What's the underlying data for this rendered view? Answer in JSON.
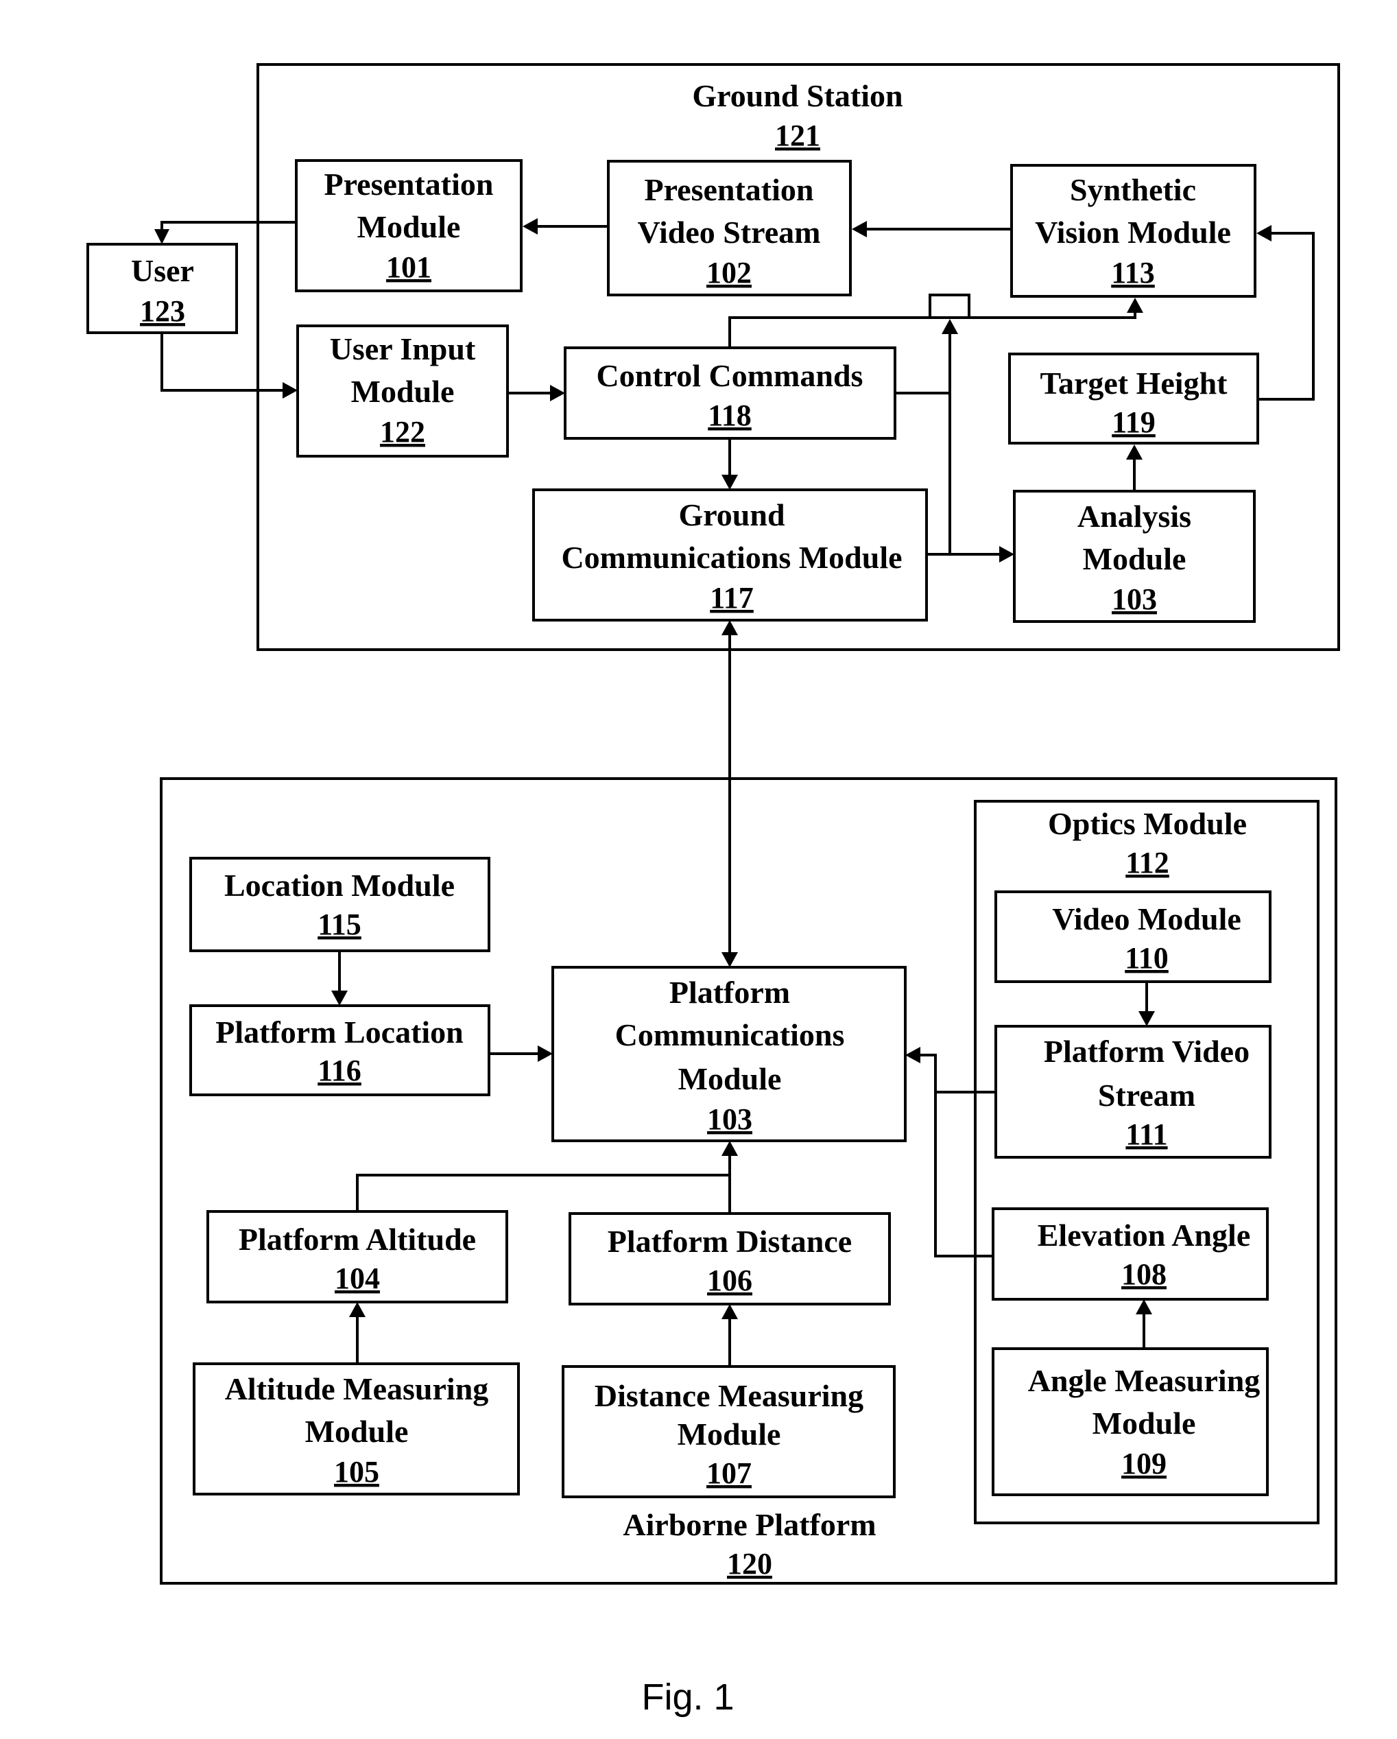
{
  "figure": {
    "caption": "Fig. 1"
  },
  "ground_station": {
    "title": "Ground Station",
    "ref": "121",
    "modules": {
      "presentation_module": {
        "lines": [
          "Presentation",
          "Module"
        ],
        "ref": "101"
      },
      "presentation_video_stream": {
        "lines": [
          "Presentation",
          "Video Stream"
        ],
        "ref": "102"
      },
      "synthetic_vision_module": {
        "lines": [
          "Synthetic",
          "Vision Module"
        ],
        "ref": "113"
      },
      "user_input_module": {
        "lines": [
          "User Input",
          "Module"
        ],
        "ref": "122"
      },
      "control_commands": {
        "lines": [
          "Control Commands"
        ],
        "ref": "118"
      },
      "target_height": {
        "lines": [
          "Target Height"
        ],
        "ref": "119"
      },
      "ground_communications_module": {
        "lines": [
          "Ground",
          "Communications Module"
        ],
        "ref": "117"
      },
      "analysis_module": {
        "lines": [
          "Analysis",
          "Module"
        ],
        "ref": "103"
      }
    }
  },
  "user": {
    "lines": [
      "User"
    ],
    "ref": "123"
  },
  "airborne_platform": {
    "title": "Airborne Platform",
    "ref": "120",
    "modules": {
      "location_module": {
        "lines": [
          "Location Module"
        ],
        "ref": "115"
      },
      "platform_location": {
        "lines": [
          "Platform Location"
        ],
        "ref": "116"
      },
      "platform_communications_module": {
        "lines": [
          "Platform",
          "Communications",
          "Module"
        ],
        "ref": "103"
      },
      "platform_altitude": {
        "lines": [
          "Platform Altitude"
        ],
        "ref": "104"
      },
      "platform_distance": {
        "lines": [
          "Platform Distance"
        ],
        "ref": "106"
      },
      "altitude_measuring_module": {
        "lines": [
          "Altitude Measuring",
          "Module"
        ],
        "ref": "105"
      },
      "distance_measuring_module": {
        "lines": [
          "Distance Measuring",
          "Module"
        ],
        "ref": "107"
      }
    },
    "optics_module": {
      "title": "Optics Module",
      "ref": "112",
      "modules": {
        "video_module": {
          "lines": [
            "Video Module"
          ],
          "ref": "110"
        },
        "platform_video_stream": {
          "lines": [
            "Platform Video",
            "Stream"
          ],
          "ref": "111"
        },
        "elevation_angle": {
          "lines": [
            "Elevation Angle"
          ],
          "ref": "108"
        },
        "angle_measuring_module": {
          "lines": [
            "Angle Measuring",
            "Module"
          ],
          "ref": "109"
        }
      }
    }
  }
}
